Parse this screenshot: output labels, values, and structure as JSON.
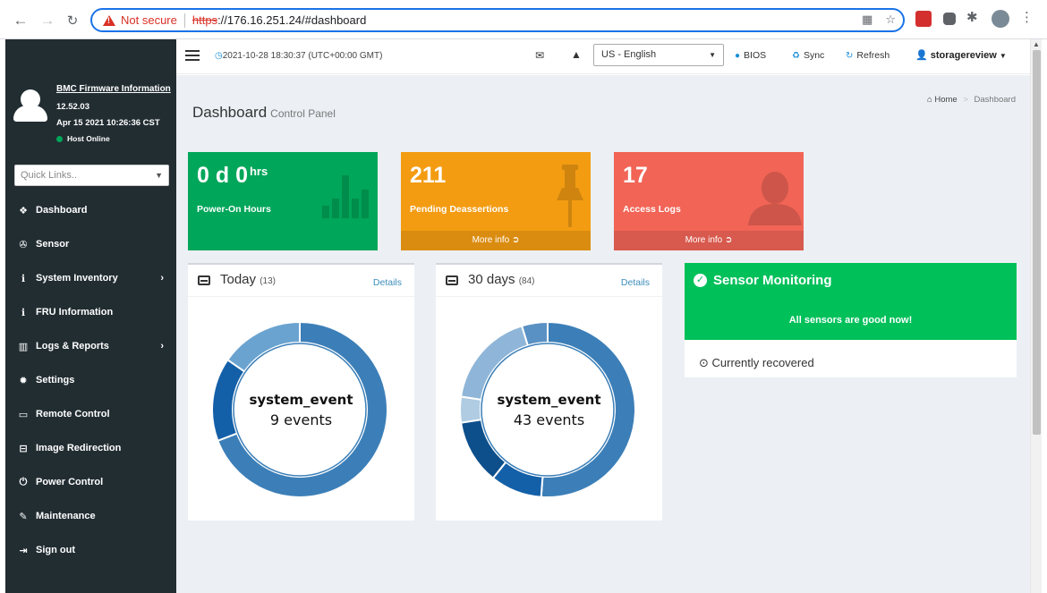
{
  "browser": {
    "not_secure": "Not secure",
    "url_scheme": "https",
    "url_rest": "://176.16.251.24/#dashboard"
  },
  "sidebar": {
    "fw_title": "BMC Firmware Information",
    "fw_version": "12.52.03",
    "fw_date": "Apr 15 2021 10:26:36 CST",
    "host_status": "Host Online",
    "quick_links_placeholder": "Quick Links..",
    "items": [
      {
        "label": "Dashboard",
        "icon": "dashboard-icon",
        "glyph": "❖",
        "has_children": false
      },
      {
        "label": "Sensor",
        "icon": "sensor-icon",
        "glyph": "✇",
        "has_children": false
      },
      {
        "label": "System Inventory",
        "icon": "info-icon",
        "glyph": "ℹ",
        "has_children": true
      },
      {
        "label": "FRU Information",
        "icon": "info-icon",
        "glyph": "ℹ",
        "has_children": false
      },
      {
        "label": "Logs & Reports",
        "icon": "bar-chart-icon",
        "glyph": "▥",
        "has_children": true
      },
      {
        "label": "Settings",
        "icon": "gear-icon",
        "glyph": "✹",
        "has_children": false
      },
      {
        "label": "Remote Control",
        "icon": "monitor-icon",
        "glyph": "▭",
        "has_children": false
      },
      {
        "label": "Image Redirection",
        "icon": "drive-icon",
        "glyph": "⊟",
        "has_children": false
      },
      {
        "label": "Power Control",
        "icon": "power-icon",
        "glyph": "⏻",
        "has_children": false
      },
      {
        "label": "Maintenance",
        "icon": "wrench-icon",
        "glyph": "✎",
        "has_children": false
      },
      {
        "label": "Sign out",
        "icon": "sign-out-icon",
        "glyph": "⇥",
        "has_children": false
      }
    ]
  },
  "header": {
    "datetime": "2021-10-28 18:30:37 (UTC+00:00 GMT)",
    "language": "US - English",
    "bios": "BIOS",
    "sync": "Sync",
    "refresh": "Refresh",
    "username": "storagereview"
  },
  "page": {
    "title": "Dashboard",
    "subtitle": "Control Panel",
    "breadcrumb_home": "Home",
    "breadcrumb_current": "Dashboard"
  },
  "boxes": {
    "power_on": {
      "value": "0 d 0",
      "unit": "hrs",
      "label": "Power-On Hours"
    },
    "pending": {
      "value": "211",
      "label": "Pending Deassertions",
      "more": "More info"
    },
    "access": {
      "value": "17",
      "label": "Access Logs",
      "more": "More info"
    }
  },
  "today": {
    "title": "Today",
    "count": "(13)",
    "details": "Details",
    "center_label": "system_event",
    "center_value": "9 events",
    "segments": [
      {
        "value": 9,
        "color": "#3c7fb8"
      },
      {
        "value": 2,
        "color": "#1460a8"
      },
      {
        "value": 2,
        "color": "#6aa3d0"
      }
    ]
  },
  "month": {
    "title": "30 days",
    "count": "(84)",
    "details": "Details",
    "center_label": "system_event",
    "center_value": "43 events",
    "segments": [
      {
        "value": 43,
        "color": "#3c7fb8"
      },
      {
        "value": 8,
        "color": "#1460a8"
      },
      {
        "value": 10,
        "color": "#0d4f8b"
      },
      {
        "value": 4,
        "color": "#b0cce3"
      },
      {
        "value": 15,
        "color": "#8fb6d8"
      },
      {
        "value": 4,
        "color": "#5a91c4"
      }
    ]
  },
  "sensor": {
    "title": "Sensor Monitoring",
    "status": "All sensors are good now!",
    "recovered": "Currently recovered"
  }
}
